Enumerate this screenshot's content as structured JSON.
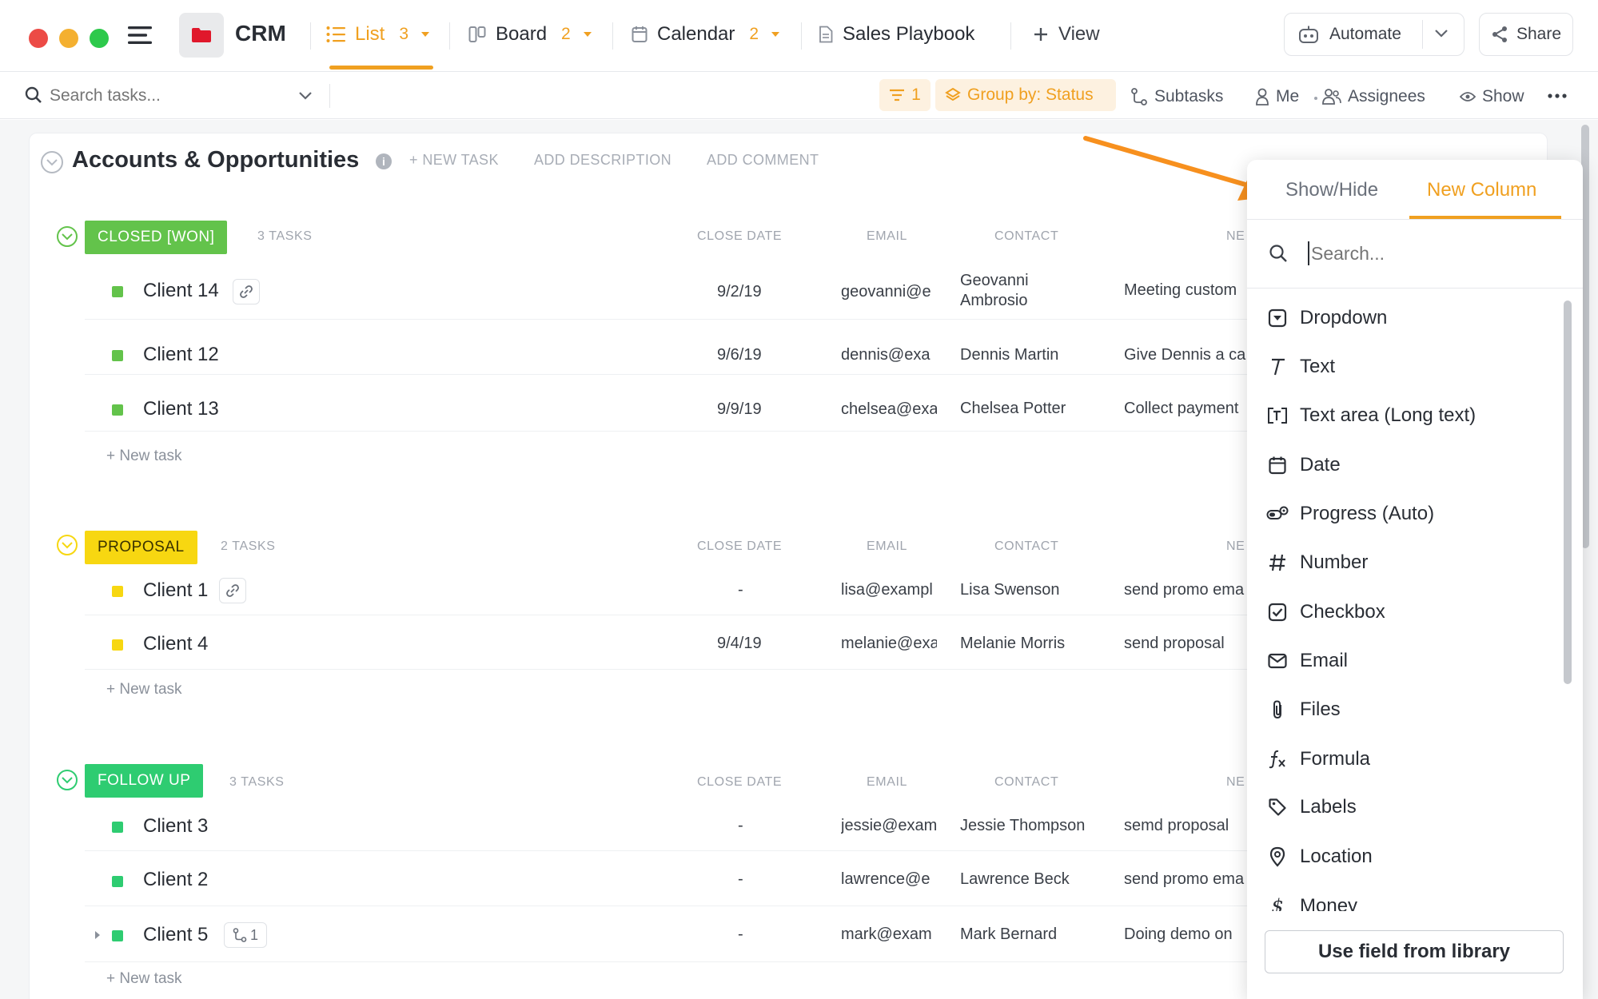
{
  "app": {
    "title": "CRM"
  },
  "views": {
    "list": {
      "label": "List",
      "count": "3"
    },
    "board": {
      "label": "Board",
      "count": "2"
    },
    "calendar": {
      "label": "Calendar",
      "count": "2"
    },
    "playbook": {
      "label": "Sales Playbook"
    },
    "add_view": {
      "label": "View"
    }
  },
  "actions": {
    "automate": "Automate",
    "share": "Share"
  },
  "toolbar": {
    "search_placeholder": "Search tasks...",
    "filter_count": "1",
    "group_by": "Group by: Status",
    "subtasks": "Subtasks",
    "me": "Me",
    "assignees": "Assignees",
    "show": "Show"
  },
  "list": {
    "title": "Accounts & Opportunities",
    "new_task": "+ NEW TASK",
    "add_description": "ADD DESCRIPTION",
    "add_comment": "ADD COMMENT"
  },
  "columns": {
    "close_date": "CLOSE DATE",
    "email": "EMAIL",
    "contact": "CONTACT",
    "next": "NE"
  },
  "groups": [
    {
      "status": "CLOSED [WON]",
      "count_label": "3 TASKS",
      "color": "#63c34b",
      "new_task": "+ New task",
      "tasks": [
        {
          "name": "Client 14",
          "date": "9/2/19",
          "email": "geovanni@e",
          "contact_line1": "Geovanni",
          "contact_line2": "Ambrosio",
          "next": "Meeting custom"
        },
        {
          "name": "Client 12",
          "date": "9/6/19",
          "email": "dennis@exa",
          "contact_line1": "Dennis Martin",
          "next": "Give Dennis a ca"
        },
        {
          "name": "Client 13",
          "date": "9/9/19",
          "email": "chelsea@exa",
          "contact_line1": "Chelsea Potter",
          "next": "Collect payment"
        }
      ]
    },
    {
      "status": "PROPOSAL",
      "count_label": "2 TASKS",
      "color": "#f7d711",
      "new_task": "+ New task",
      "tasks": [
        {
          "name": "Client 1",
          "date": "-",
          "email": "lisa@exampl",
          "contact_line1": "Lisa Swenson",
          "next": "send promo ema"
        },
        {
          "name": "Client 4",
          "date": "9/4/19",
          "email": "melanie@exa",
          "contact_line1": "Melanie Morris",
          "next": "send proposal"
        }
      ]
    },
    {
      "status": "FOLLOW UP",
      "count_label": "3 TASKS",
      "color": "#2ecc71",
      "new_task": "+ New task",
      "tasks": [
        {
          "name": "Client 3",
          "date": "-",
          "email": "jessie@exam",
          "contact_line1": "Jessie Thompson",
          "next": "semd proposal"
        },
        {
          "name": "Client 2",
          "date": "-",
          "email": "lawrence@e",
          "contact_line1": "Lawrence Beck",
          "next": "send promo ema"
        },
        {
          "name": "Client 5",
          "date": "-",
          "email": "mark@exam",
          "contact_line1": "Mark Bernard",
          "next": "Doing demo on",
          "subtask_count": "1"
        }
      ]
    }
  ],
  "popup": {
    "tab_show_hide": "Show/Hide",
    "tab_new_column": "New Column",
    "search_placeholder": "Search...",
    "fields": [
      "Dropdown",
      "Text",
      "Text area (Long text)",
      "Date",
      "Progress (Auto)",
      "Number",
      "Checkbox",
      "Email",
      "Files",
      "Formula",
      "Labels",
      "Location",
      "Money"
    ],
    "library_button": "Use field from library"
  },
  "colors": {
    "accent": "#f0a020",
    "annotation_arrow": "#f7901e"
  }
}
